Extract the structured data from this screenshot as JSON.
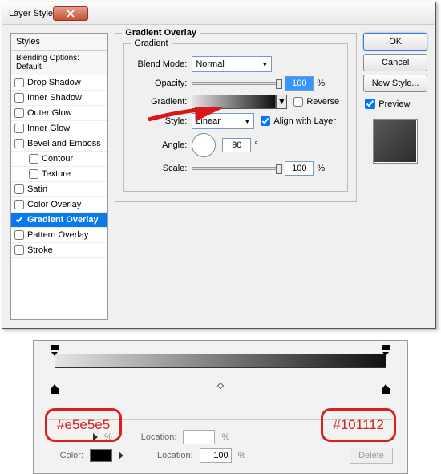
{
  "dialog": {
    "title": "Layer Style",
    "section_title": "Gradient Overlay",
    "inner_title": "Gradient"
  },
  "styles_panel": {
    "header": "Styles",
    "subheader": "Blending Options: Default",
    "items": [
      {
        "label": "Drop Shadow",
        "checked": false,
        "selected": false,
        "indent": false
      },
      {
        "label": "Inner Shadow",
        "checked": false,
        "selected": false,
        "indent": false
      },
      {
        "label": "Outer Glow",
        "checked": false,
        "selected": false,
        "indent": false
      },
      {
        "label": "Inner Glow",
        "checked": false,
        "selected": false,
        "indent": false
      },
      {
        "label": "Bevel and Emboss",
        "checked": false,
        "selected": false,
        "indent": false
      },
      {
        "label": "Contour",
        "checked": false,
        "selected": false,
        "indent": true
      },
      {
        "label": "Texture",
        "checked": false,
        "selected": false,
        "indent": true
      },
      {
        "label": "Satin",
        "checked": false,
        "selected": false,
        "indent": false
      },
      {
        "label": "Color Overlay",
        "checked": false,
        "selected": false,
        "indent": false
      },
      {
        "label": "Gradient Overlay",
        "checked": true,
        "selected": true,
        "indent": false
      },
      {
        "label": "Pattern Overlay",
        "checked": false,
        "selected": false,
        "indent": false
      },
      {
        "label": "Stroke",
        "checked": false,
        "selected": false,
        "indent": false
      }
    ]
  },
  "fields": {
    "blend_mode_label": "Blend Mode:",
    "blend_mode_value": "Normal",
    "opacity_label": "Opacity:",
    "opacity_value": "100",
    "opacity_unit": "%",
    "gradient_label": "Gradient:",
    "reverse_label": "Reverse",
    "reverse_checked": false,
    "style_label": "Style:",
    "style_value": "Linear",
    "align_label": "Align with Layer",
    "align_checked": true,
    "angle_label": "Angle:",
    "angle_value": "90",
    "angle_unit": "°",
    "scale_label": "Scale:",
    "scale_value": "100",
    "scale_unit": "%"
  },
  "buttons": {
    "ok": "OK",
    "cancel": "Cancel",
    "new_style": "New Style...",
    "preview_label": "Preview",
    "preview_checked": true
  },
  "gradient_editor": {
    "stop_left_color": "#e5e5e5",
    "stop_right_color": "#101112",
    "opacity_row": {
      "spacer": "",
      "tri": "▸",
      "pct": "%",
      "loc_label": "Location:",
      "loc_pct": "%"
    },
    "color_row": {
      "label": "Color:",
      "tri": "▸",
      "loc_label": "Location:",
      "loc_value": "100",
      "loc_pct": "%",
      "delete": "Delete"
    }
  }
}
